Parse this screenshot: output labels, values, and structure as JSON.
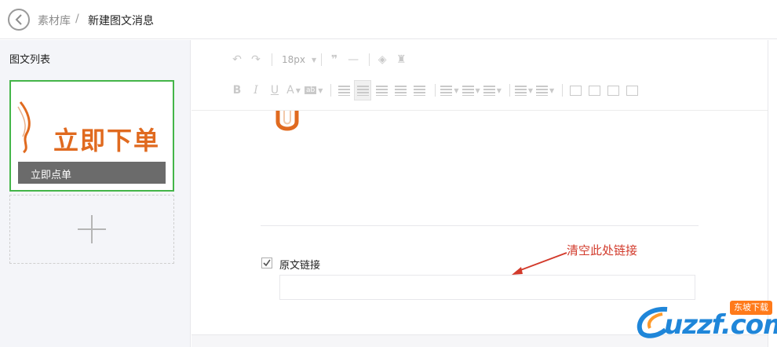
{
  "header": {
    "breadcrumb_link": "素材库",
    "breadcrumb_separator": "/",
    "breadcrumb_current": "新建图文消息"
  },
  "sidebar": {
    "title": "图文列表",
    "card": {
      "cover_text": "立即下单",
      "title": "立即点单"
    }
  },
  "toolbar": {
    "font_size": "18px"
  },
  "form": {
    "original_link_label": "原文链接",
    "original_link_checked": true,
    "original_link_value": ""
  },
  "annotation": {
    "text": "清空此处链接",
    "color": "#d23a2b"
  },
  "watermark": {
    "logo_text": "uzzf.com",
    "badge_text": "东坡下载"
  },
  "colors": {
    "selected_border": "#44b549",
    "cover_text": "#e06a1f"
  }
}
